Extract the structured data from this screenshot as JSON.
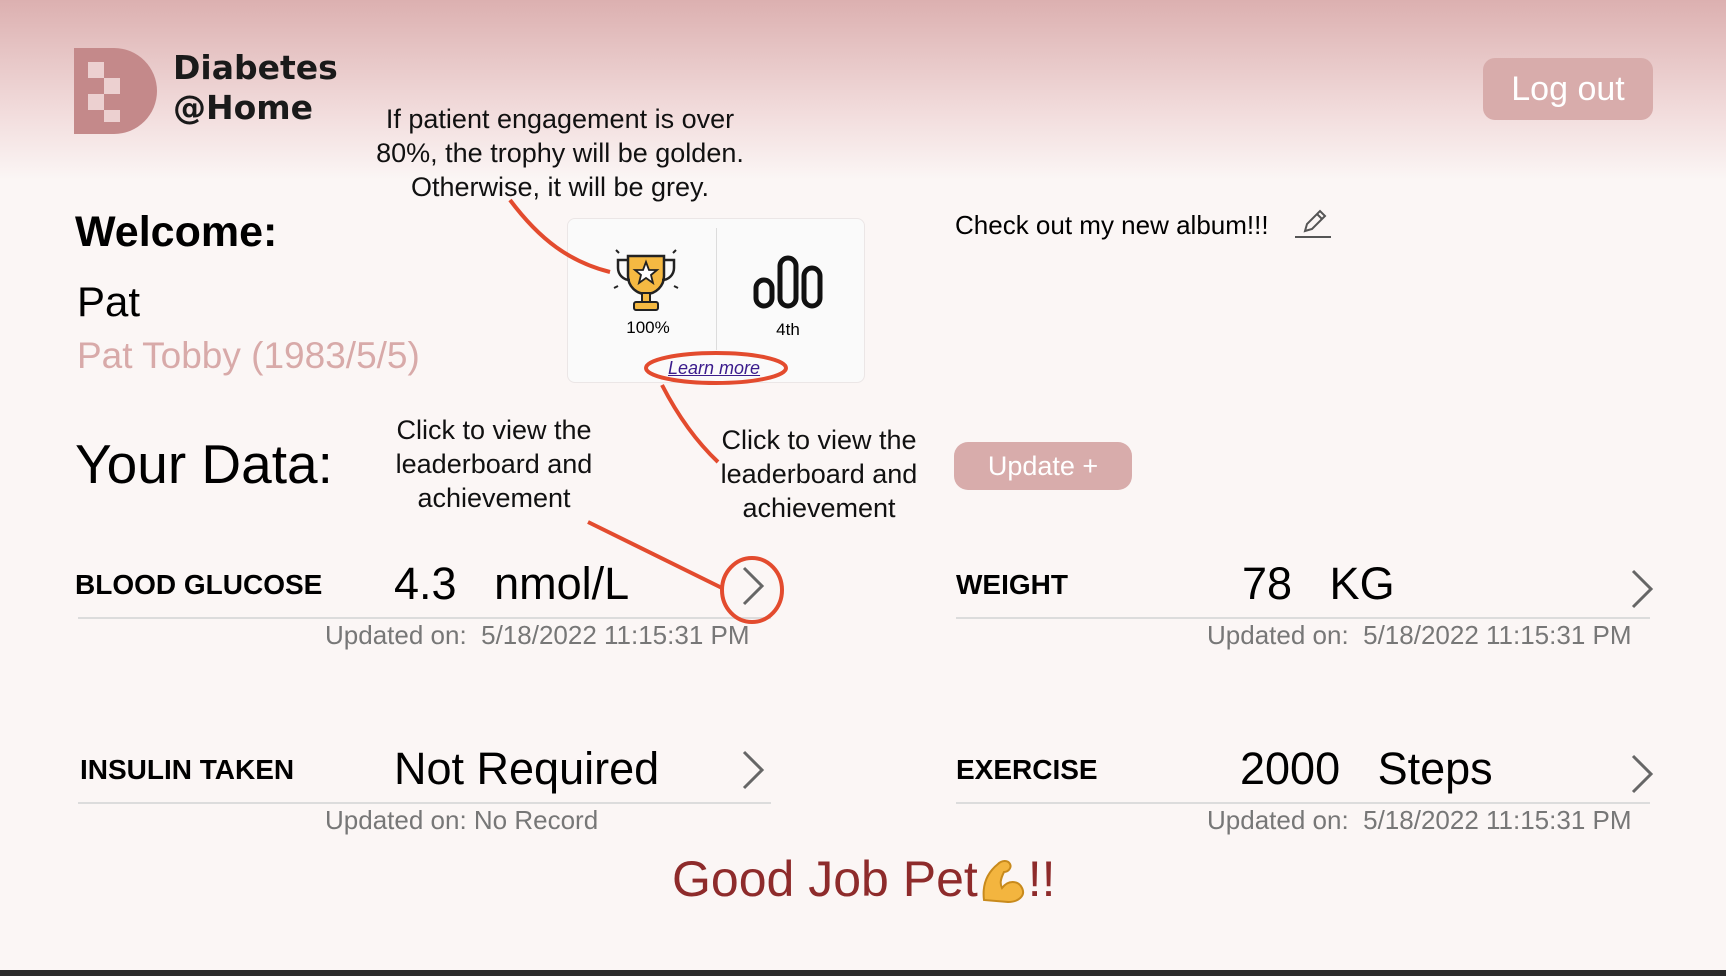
{
  "app": {
    "logo_line1": "Diabetes",
    "logo_line2": "@Home",
    "logout_label": "Log out"
  },
  "user": {
    "welcome_label": "Welcome:",
    "short_name": "Pat",
    "full_name": "Pat Tobby (1983/5/5)"
  },
  "engagement": {
    "percent": "100%",
    "rank": "4th",
    "learn_more": "Learn more"
  },
  "status": {
    "text": "Check out my new album!!!"
  },
  "data_section": {
    "title": "Your Data:",
    "update_label": "Update +"
  },
  "metrics": {
    "blood_glucose": {
      "label": "BLOOD GLUCOSE",
      "value": "4.3   nmol/L",
      "updated": "Updated on:  5/18/2022 11:15:31 PM"
    },
    "weight": {
      "label": "WEIGHT",
      "value": "78   KG",
      "updated": "Updated on:  5/18/2022 11:15:31 PM"
    },
    "insulin": {
      "label": "INSULIN TAKEN",
      "value": "Not Required",
      "updated": "Updated on: No Record"
    },
    "exercise": {
      "label": "EXERCISE",
      "value": "2000   Steps",
      "updated": "Updated on:  5/18/2022 11:15:31 PM"
    }
  },
  "encouragement": {
    "prefix": "Good Job Pet",
    "suffix": "!!"
  },
  "annotations": {
    "trophy_note": "If patient engagement is over 80%, the trophy will be golden. Otherwise, it will be grey.",
    "chevron_note": "Click to view the leaderboard and achievement",
    "learn_more_note": "Click to view the leaderboard and achievement"
  },
  "icons": [
    "logo-icon",
    "trophy-icon",
    "leaderboard-icon",
    "pencil-icon",
    "chevron-right-icon",
    "flexed-biceps-icon"
  ],
  "colors": {
    "accent": "#d8acab",
    "praise": "#8e2b2b",
    "annotation": "#e34b2e",
    "trophy": "#f5b942"
  }
}
